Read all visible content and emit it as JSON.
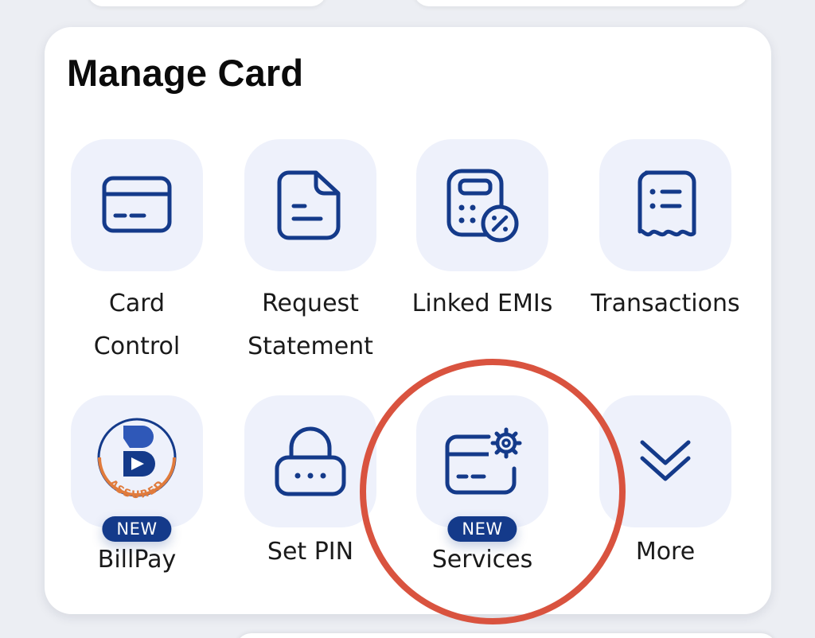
{
  "card": {
    "title": "Manage Card"
  },
  "tiles": [
    {
      "label": "Card\nControl",
      "icon": "credit-card-icon"
    },
    {
      "label": "Request\nStatement",
      "icon": "document-icon"
    },
    {
      "label": "Linked EMIs",
      "icon": "calculator-percent-icon"
    },
    {
      "label": "Transactions",
      "icon": "receipt-icon"
    },
    {
      "label": "BillPay",
      "icon": "bharat-billpay-assured-logo",
      "badge": "NEW",
      "logo_text": "ASSURED"
    },
    {
      "label": "Set PIN",
      "icon": "lock-icon"
    },
    {
      "label": "Services",
      "icon": "card-settings-icon",
      "badge": "NEW"
    },
    {
      "label": "More",
      "icon": "chevron-double-down-icon"
    }
  ],
  "colors": {
    "icon_stroke": "#143a8a",
    "tile_background": "#eef1fb",
    "badge_background": "#143a8a",
    "highlight": "#d9533f",
    "logo_orange": "#e07b3c"
  }
}
